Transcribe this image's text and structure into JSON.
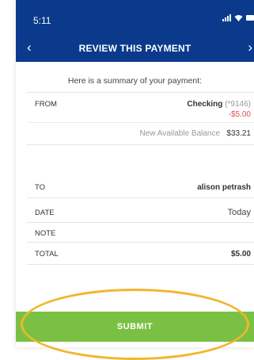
{
  "status": {
    "time": "5:11",
    "icons": [
      "signal-icon",
      "wifi-icon",
      "battery-icon"
    ]
  },
  "nav": {
    "title": "REVIEW THIS PAYMENT",
    "back_icon": "chevron-left-icon",
    "forward_icon": "chevron-right-icon"
  },
  "summary": {
    "intro": "Here is a summary of your payment:"
  },
  "from": {
    "label": "FROM",
    "account_name": "Checking",
    "account_number": "(*9146)",
    "amount": "-$5.00",
    "balance_label": "New Available Balance",
    "balance_value": "$33.21"
  },
  "to": {
    "label": "TO",
    "value": "alison petrash"
  },
  "date": {
    "label": "DATE",
    "value": "Today"
  },
  "note": {
    "label": "NOTE",
    "value": ""
  },
  "total": {
    "label": "TOTAL",
    "value": "$5.00"
  },
  "submit": {
    "label": "SUBMIT"
  },
  "colors": {
    "header": "#0b3a8c",
    "submit": "#7ac143",
    "highlight": "#efb72b",
    "negative": "#d9534f"
  }
}
